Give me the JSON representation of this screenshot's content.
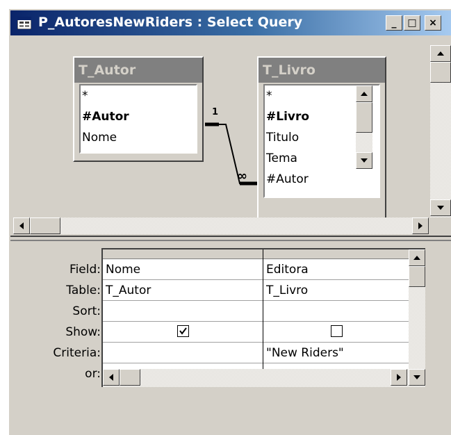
{
  "window": {
    "title": "P_AutoresNewRiders : Select Query",
    "minimize_glyph": "_",
    "maximize_glyph": "□",
    "close_glyph": "×"
  },
  "tables": [
    {
      "name": "T_Autor",
      "fields": [
        "*",
        "#Autor",
        "Nome"
      ],
      "bold_index": 1
    },
    {
      "name": "T_Livro",
      "fields": [
        "*",
        "#Livro",
        "Titulo",
        "Tema",
        "#Autor"
      ],
      "bold_index": 1
    }
  ],
  "relationship": {
    "one_label": "1",
    "many_label": "∞"
  },
  "grid": {
    "row_labels": [
      "Field:",
      "Table:",
      "Sort:",
      "Show:",
      "Criteria:",
      "or:"
    ],
    "columns": [
      {
        "field": "Nome",
        "table": "T_Autor",
        "sort": "",
        "show": true,
        "criteria": "",
        "or": ""
      },
      {
        "field": "Editora",
        "table": "T_Livro",
        "sort": "",
        "show": false,
        "criteria": "\"New Riders\"",
        "or": ""
      }
    ]
  },
  "colors": {
    "titlebar_start": "#0a246a",
    "titlebar_end": "#a6caf0",
    "face": "#d4d0c8"
  }
}
